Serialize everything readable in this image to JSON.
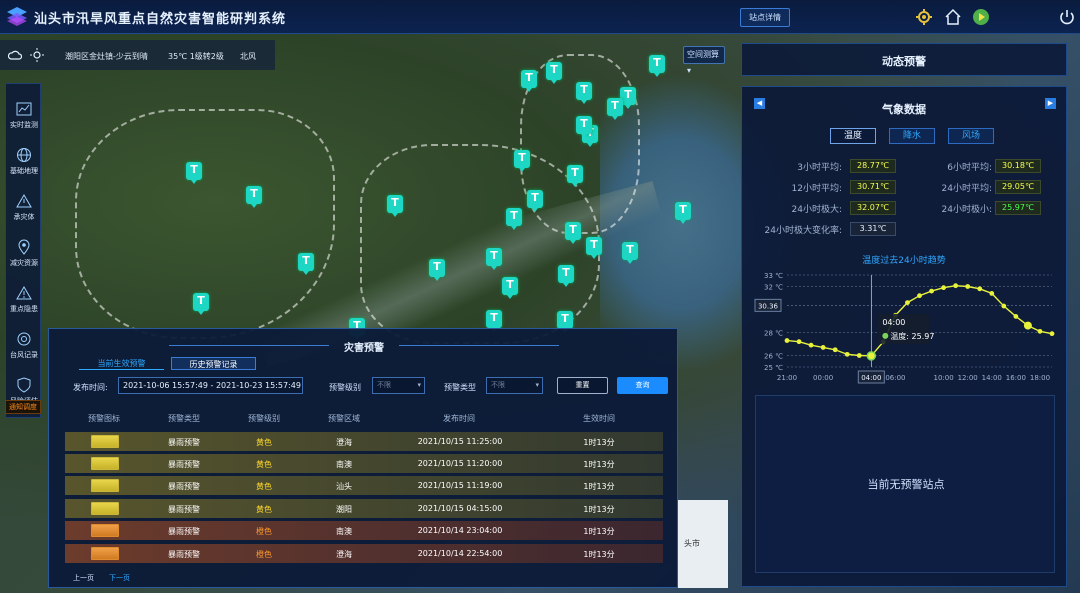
{
  "header": {
    "title": "汕头市汛旱风重点自然灾害智能研判系统",
    "station_btn": "站点详情"
  },
  "weather_bar": {
    "location": "潮阳区金灶镇-少云到晴",
    "temp_wind": "35℃ 1级转2级",
    "direction": "北风"
  },
  "map": {
    "space_select": "空间测算 ▾"
  },
  "sidebar": {
    "items": [
      {
        "label": "实时监测"
      },
      {
        "label": "基础地理"
      },
      {
        "label": "承灾体"
      },
      {
        "label": "减灾资源"
      },
      {
        "label": "重点隐患"
      },
      {
        "label": "台风记录"
      },
      {
        "label": "风险评估"
      }
    ],
    "alarm_label": "通知调度"
  },
  "disaster_panel": {
    "title": "灾害预警",
    "tabs": [
      "当前生效预警",
      "历史预警记录"
    ],
    "filters": {
      "time_label": "发布时间:",
      "time_value": "2021-10-06 15:57:49 - 2021-10-23 15:57:49",
      "level_label": "预警级别",
      "level_value": "不限",
      "type_label": "预警类型",
      "type_value": "不限",
      "reset": "重置",
      "query": "查询"
    },
    "columns": [
      "预警图标",
      "预警类型",
      "预警级别",
      "预警区域",
      "发布时间",
      "生效时间"
    ],
    "rows": [
      {
        "type": "暴雨预警",
        "level": "黄色",
        "area": "澄海",
        "time": "2021/10/15 11:25:00",
        "duration": "1时13分"
      },
      {
        "type": "暴雨预警",
        "level": "黄色",
        "area": "南澳",
        "time": "2021/10/15 11:20:00",
        "duration": "1时13分"
      },
      {
        "type": "暴雨预警",
        "level": "黄色",
        "area": "汕头",
        "time": "2021/10/15 11:19:00",
        "duration": "1时13分"
      },
      {
        "type": "暴雨预警",
        "level": "黄色",
        "area": "潮阳",
        "time": "2021/10/15 04:15:00",
        "duration": "1时13分"
      },
      {
        "type": "暴雨预警",
        "level": "橙色",
        "area": "南澳",
        "time": "2021/10/14 23:04:00",
        "duration": "1时13分"
      },
      {
        "type": "暴雨预警",
        "level": "橙色",
        "area": "澄海",
        "time": "2021/10/14 22:54:00",
        "duration": "1时13分"
      }
    ],
    "prev": "上一页",
    "next": "下一页"
  },
  "minimap": {
    "label": "头市"
  },
  "right_panel": {
    "header": "动态预警",
    "weather_title": "气象数据",
    "tabs": [
      "温度",
      "降水",
      "风场"
    ],
    "stats": {
      "avg3_label": "3小时平均:",
      "avg3": "28.77℃",
      "avg6_label": "6小时平均:",
      "avg6": "30.18℃",
      "avg12_label": "12小时平均:",
      "avg12": "30.71℃",
      "avg24_label": "24小时平均:",
      "avg24": "29.05℃",
      "max24_label": "24小时极大:",
      "max24": "32.07℃",
      "min24_label": "24小时极小:",
      "min24": "25.97℃",
      "change_label": "24小时极大变化率:",
      "change": "3.31℃"
    },
    "chart_title": "温度过去24小时趋势",
    "no_warning": "当前无预警站点"
  },
  "chart_data": {
    "type": "line",
    "title": "温度过去24小时趋势",
    "x": [
      "21:00",
      "22:00",
      "23:00",
      "00:00",
      "01:00",
      "02:00",
      "03:00",
      "04:00",
      "05:00",
      "06:00",
      "07:00",
      "08:00",
      "09:00",
      "10:00",
      "11:00",
      "12:00",
      "13:00",
      "14:00",
      "15:00",
      "16:00",
      "17:00",
      "18:00",
      "19:00"
    ],
    "x_ticks": [
      "21:00",
      "00:00",
      "04:00",
      "06:00",
      "10:00",
      "12:00",
      "14:00",
      "16:00",
      "18:00"
    ],
    "y_ticks": [
      "25 ℃",
      "26 ℃",
      "28 ℃",
      "30.36",
      "32 ℃",
      "33 ℃"
    ],
    "ylim": [
      25,
      33
    ],
    "series": [
      {
        "values": [
          27.3,
          27.2,
          26.9,
          26.7,
          26.5,
          26.1,
          26.0,
          25.97,
          27.2,
          29.5,
          30.6,
          31.2,
          31.6,
          31.9,
          32.07,
          32.0,
          31.8,
          31.4,
          30.3,
          29.4,
          28.6,
          28.1,
          27.9
        ]
      }
    ],
    "tooltip": {
      "time": "04:00",
      "label": "温度:",
      "value": "25.97"
    },
    "crosshair_y_label": "30.36",
    "crosshair_x_label": "04:00",
    "grid": true
  }
}
